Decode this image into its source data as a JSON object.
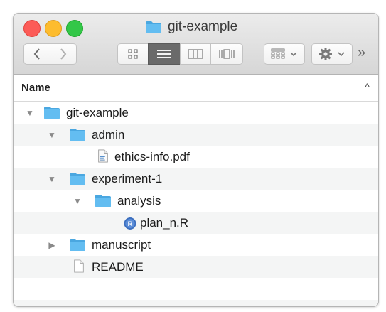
{
  "window": {
    "title": "git-example"
  },
  "toolbar": {
    "back_icon": "chevron-left",
    "forward_icon": "chevron-right",
    "view_buttons": [
      "icon-view",
      "list-view",
      "column-view",
      "cover-flow-view"
    ],
    "arrange_icon": "grid-arrange",
    "action_icon": "gear",
    "overflow_label": "»"
  },
  "column_header": {
    "name_label": "Name",
    "sort_indicator": "^"
  },
  "tree": [
    {
      "label": "git-example",
      "type": "folder",
      "expanded": true
    },
    {
      "label": "admin",
      "type": "folder",
      "expanded": true
    },
    {
      "label": "ethics-info.pdf",
      "type": "pdf"
    },
    {
      "label": "experiment-1",
      "type": "folder",
      "expanded": true
    },
    {
      "label": "analysis",
      "type": "folder",
      "expanded": true
    },
    {
      "label": "plan_n.R",
      "type": "r-script"
    },
    {
      "label": "manuscript",
      "type": "folder",
      "expanded": false
    },
    {
      "label": "README",
      "type": "document"
    }
  ],
  "colors": {
    "folder_blue": "#63bdf1",
    "folder_tab": "#4aa7e0",
    "close": "#fc5b57",
    "minimize": "#fdbc2e",
    "maximize": "#33c748"
  }
}
